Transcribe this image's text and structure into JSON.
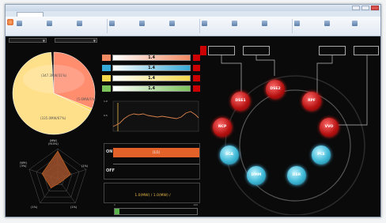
{
  "window": {
    "title": "",
    "tabs": [
      {
        "label": ""
      },
      {
        "label": ""
      }
    ]
  },
  "ribbon": {
    "buttons": [
      {
        "label": ""
      },
      {
        "label": ""
      },
      {
        "label": ""
      },
      {
        "label": ""
      },
      {
        "label": ""
      },
      {
        "label": ""
      },
      {
        "label": ""
      },
      {
        "label": ""
      },
      {
        "label": ""
      },
      {
        "label": ""
      },
      {
        "label": ""
      },
      {
        "label": ""
      }
    ]
  },
  "filters": {
    "left_value": "",
    "right_value": ""
  },
  "pie": {
    "slices": [
      {
        "label": "",
        "value_text": "(347.3MW/31%)",
        "fraction": 0.31,
        "color": "#ff8d6e"
      },
      {
        "label": "",
        "value_text": "(5.6MW/1%)",
        "fraction": 0.01,
        "color": "#ffd75a"
      },
      {
        "label": "",
        "value_text": "(335.0MW/67%)",
        "fraction": 0.67,
        "color": "#ffe08a"
      }
    ]
  },
  "radar": {
    "axes": [
      {
        "label": "(MW)",
        "sub": "(915%)"
      },
      {
        "label": "",
        "sub": "(1%)"
      },
      {
        "label": "",
        "sub": "(1%)"
      },
      {
        "label": "",
        "sub": "(1%)"
      },
      {
        "label": "(WH)",
        "sub": "(3%)"
      }
    ],
    "values": [
      0.92,
      0.45,
      0.15,
      0.38,
      0.55
    ],
    "color": "#a0522d"
  },
  "bars": [
    {
      "tag": "",
      "value": "1.4",
      "unit": "",
      "color": "#f28a63"
    },
    {
      "tag": "",
      "value": "1.4",
      "unit": "",
      "color": "#36a9d8"
    },
    {
      "tag": "",
      "value": "1.4",
      "unit": "",
      "color": "#f5d94a"
    },
    {
      "tag": "",
      "value": "1.4",
      "unit": "",
      "color": "#7cc35b"
    }
  ],
  "trend": {
    "y_top": "1.0",
    "y_mid": "0.5",
    "x_start": "",
    "x_end": ""
  },
  "status": {
    "on": "ON",
    "off": "OFF",
    "message": "(1/1)"
  },
  "generation": {
    "line1": "",
    "line2": "1.0(MW) / 1.0(MW) /"
  },
  "progress": {
    "label": "",
    "fraction": 0.06,
    "fill_text": "1",
    "tick_start": "0",
    "tick_end": "100"
  },
  "network": {
    "top_boxes": [
      {
        "line1": "",
        "line2": ""
      },
      {
        "line1": "",
        "line2": ""
      },
      {
        "line1": "",
        "line2": ""
      },
      {
        "line1": "",
        "line2": ""
      }
    ],
    "red_tag": "",
    "nodes": [
      {
        "name": "DSE2",
        "kind": "red"
      },
      {
        "name": "DSE1",
        "kind": "red"
      },
      {
        "name": "RPF",
        "kind": "red"
      },
      {
        "name": "NCP",
        "kind": "red"
      },
      {
        "name": "VVO",
        "kind": "red"
      },
      {
        "name": "SCA",
        "kind": "blue"
      },
      {
        "name": "PCE",
        "kind": "blue"
      },
      {
        "name": "DMM",
        "kind": "blue"
      },
      {
        "name": "DSR",
        "kind": "blue"
      }
    ]
  },
  "colors": {
    "accent_red": "#cc0000",
    "background": "#0a0a0a"
  }
}
